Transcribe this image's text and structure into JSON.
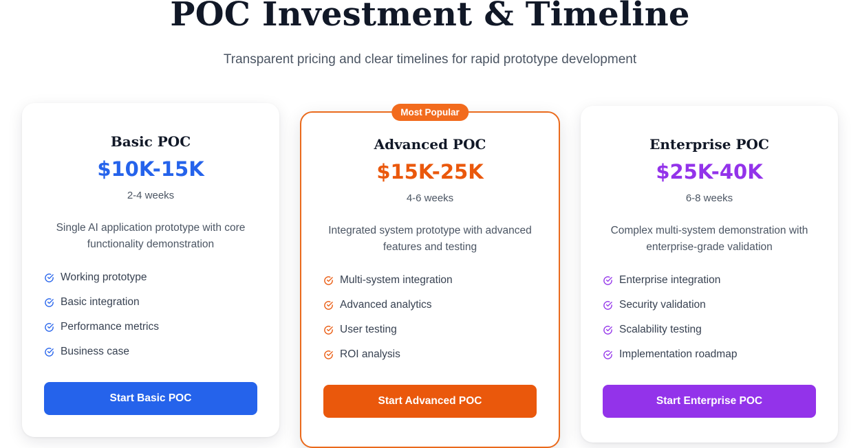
{
  "header": {
    "title": "POC Investment & Timeline",
    "subtitle": "Transparent pricing and clear timelines for rapid prototype development"
  },
  "colors": {
    "basic": "#2563eb",
    "advanced": "#ea580c",
    "enterprise": "#9333ea",
    "badge": "#f26b1d"
  },
  "plans": [
    {
      "name": "Basic POC",
      "price": "$10K-15K",
      "duration": "2-4 weeks",
      "description": "Single AI application prototype with core functionality demonstration",
      "features": [
        "Working prototype",
        "Basic integration",
        "Performance metrics",
        "Business case"
      ],
      "cta": "Start Basic POC",
      "icon": "check-circle-icon"
    },
    {
      "name": "Advanced POC",
      "badge": "Most Popular",
      "price": "$15K-25K",
      "duration": "4-6 weeks",
      "description": "Integrated system prototype with advanced features and testing",
      "features": [
        "Multi-system integration",
        "Advanced analytics",
        "User testing",
        "ROI analysis"
      ],
      "cta": "Start Advanced POC",
      "icon": "check-circle-icon"
    },
    {
      "name": "Enterprise POC",
      "price": "$25K-40K",
      "duration": "6-8 weeks",
      "description": "Complex multi-system demonstration with enterprise-grade validation",
      "features": [
        "Enterprise integration",
        "Security validation",
        "Scalability testing",
        "Implementation roadmap"
      ],
      "cta": "Start Enterprise POC",
      "icon": "check-circle-icon"
    }
  ]
}
